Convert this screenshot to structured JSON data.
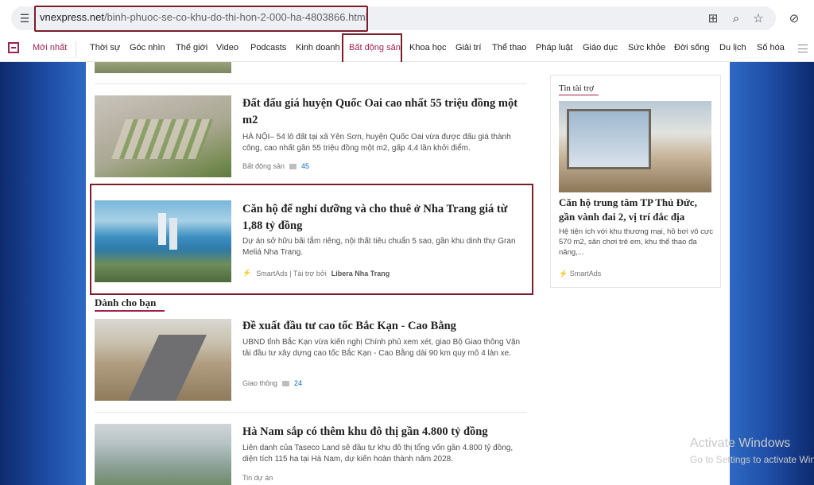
{
  "browser": {
    "url_domain": "vnexpress.net",
    "url_path": "/binh-phuoc-se-co-khu-do-thi-hon-2-000-ha-4803866.html"
  },
  "nav": {
    "items": [
      "Mới nhất",
      "Thời sự",
      "Góc nhìn",
      "Thế giới",
      "Video",
      "Podcasts",
      "Kinh doanh",
      "Bất động sản",
      "Khoa học",
      "Giải trí",
      "Thể thao",
      "Pháp luật",
      "Giáo dục",
      "Sức khỏe",
      "Đời sống",
      "Du lịch",
      "Số hóa"
    ],
    "active": "Bất động sản"
  },
  "articles": [
    {
      "title": "Đất đấu giá huyện Quốc Oai cao nhất 55 triệu đồng một m2",
      "desc": "HÀ NỘI– 54 lô đất tại xã Yên Sơn, huyện Quốc Oai vừa được đấu giá thành công, cao nhất gần 55 triệu đồng một m2, gấp 4,4 lần khởi điểm.",
      "category": "Bất động sản",
      "comments": "45"
    },
    {
      "title": "Căn hộ để nghỉ dưỡng và cho thuê ở Nha Trang giá từ 1,88 tỷ đồng",
      "desc": "Dự án sở hữu bãi tắm riêng, nội thất tiêu chuẩn 5 sao, gần khu dinh thự Gran Meliá Nha Trang.",
      "ad_prefix": "SmartAds | Tài trợ bởi",
      "sponsor": "Libera Nha Trang"
    },
    {
      "title": "Đề xuất đầu tư cao tốc Bắc Kạn - Cao Bằng",
      "desc": "UBND tỉnh Bắc Kạn vừa kiến nghị Chính phủ xem xét, giao Bộ Giao thông Vận tải đầu tư xây dựng cao tốc Bắc Kạn - Cao Bằng dài 90 km quy mô 4 làn xe.",
      "category": "Giao thông",
      "comments": "24"
    },
    {
      "title": "Hà Nam sắp có thêm khu đô thị gần 4.800 tỷ đồng",
      "desc": "Liên danh của Taseco Land sẽ đầu tư khu đô thị tổng vốn gần 4.800 tỷ đồng, diện tích 115 ha tại Hà Nam, dự kiến hoàn thành năm 2028.",
      "category": "Tin dự án"
    }
  ],
  "section": {
    "title": "Dành cho bạn"
  },
  "sidebar": {
    "label": "Tin tài trợ",
    "title": "Căn hộ trung tâm TP Thủ Đức, gần vành đai 2, vị trí đắc địa",
    "desc": "Hệ tiện ích với khu thương mại, hồ bơi vô cực 570 m2, sân chơi trẻ em, khu thể thao đa năng,...",
    "meta": "SmartAds"
  },
  "watermark": {
    "line1": "Activate Windows",
    "line2": "Go to Settings to activate Windows."
  }
}
